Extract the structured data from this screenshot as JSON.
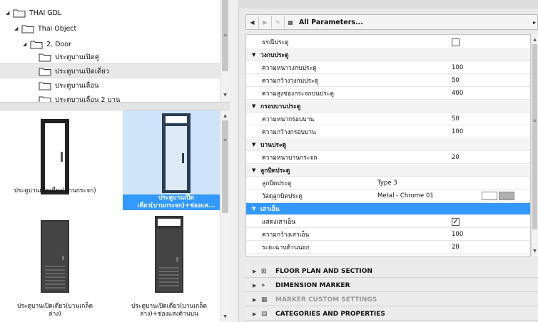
{
  "tree": {
    "items": [
      {
        "label": "THAI GDL",
        "expanded": true
      },
      {
        "label": "Thai Object",
        "expanded": true
      },
      {
        "label": "2. Door",
        "expanded": true
      },
      {
        "label": "ประตูบานเปิดคู่"
      },
      {
        "label": "ประตูบานเปิดเดี่ยว",
        "selected": true
      },
      {
        "label": "ประตูบานเลื่อน"
      },
      {
        "label": "ประตูบานเลื่อน 2 บาน"
      }
    ]
  },
  "gallery": {
    "items": [
      {
        "caption": "ประตูบานเปิดเดี่ยว(บานกระจก)"
      },
      {
        "caption": "ประตูบานเปิด\nเดี่ยว(บานกระจก)+ช่องแส...",
        "selected": true
      },
      {
        "caption": "ประตูบานเปิดเดี่ยว(บานเกล็ด\nล่าง)"
      },
      {
        "caption": "ประตูบานเปิดเดี่ยว(บานเกล็ด\nล่าง)+ช่องแสงด้านบน"
      }
    ]
  },
  "toolbar": {
    "label": "All Parameters..."
  },
  "params": {
    "rows": [
      {
        "type": "param",
        "name": "ธรณีประตู",
        "checkbox": false
      },
      {
        "type": "group",
        "name": "วงกบประตู"
      },
      {
        "type": "param",
        "name": "ความหนาวงกบประตู",
        "value": "100"
      },
      {
        "type": "param",
        "name": "ความกว้างวงกบประตู",
        "value": "50"
      },
      {
        "type": "param",
        "name": "ความสูงช่องกระจกบนประตู",
        "value": "400"
      },
      {
        "type": "group",
        "name": "กรอบบานประตู"
      },
      {
        "type": "param",
        "name": "ความหนากรอบบาน",
        "value": "50"
      },
      {
        "type": "param",
        "name": "ความกว้างกรอบบาน",
        "value": "100"
      },
      {
        "type": "group",
        "name": "บานประตู"
      },
      {
        "type": "param",
        "name": "ความหนาบานกระจก",
        "value": "20"
      },
      {
        "type": "group",
        "name": "ลูกบิดประตู"
      },
      {
        "type": "param",
        "name": "ลูกบิดประตู",
        "value2": "Type 3"
      },
      {
        "type": "param",
        "name": "วัสดุลูกบิดประตู",
        "value2": "Metal - Chrome 01",
        "swatch": true
      },
      {
        "type": "group",
        "name": "เสาเอ็น",
        "selected": true
      },
      {
        "type": "param",
        "name": "แสดงเสาเอ็น",
        "checkbox": true
      },
      {
        "type": "param",
        "name": "ความกว้างเสาเอ็น",
        "value": "100"
      },
      {
        "type": "param",
        "name": "ระยะฉาบด้านนอก",
        "value": "20"
      }
    ]
  },
  "sections": [
    {
      "label": "FLOOR PLAN AND SECTION",
      "icon": "floor-plan-icon",
      "dim": false
    },
    {
      "label": "DIMENSION MARKER",
      "icon": "dimension-marker-icon",
      "dim": false
    },
    {
      "label": "MARKER CUSTOM SETTINGS",
      "icon": "marker-settings-icon",
      "dim": true
    },
    {
      "label": "CATEGORIES AND PROPERTIES",
      "icon": "categories-icon",
      "dim": false
    }
  ],
  "colors": {
    "selection": "#3399ff",
    "selection_light": "#cfe4f8"
  }
}
